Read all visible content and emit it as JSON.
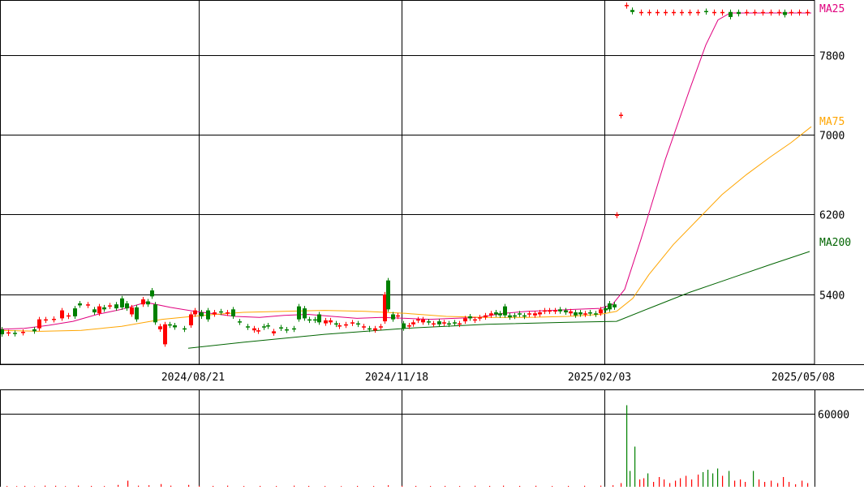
{
  "chart_data": [
    {
      "type": "candlestick",
      "y_ticks": [
        5400,
        6200,
        7000,
        7800
      ],
      "y_tick_labels": [
        "5400",
        "6200",
        "7000",
        "7800"
      ],
      "ylim": [
        4700,
        8350
      ],
      "x_tick_labels": [
        "2024/08/21",
        "2024/11/18",
        "2025/02/03",
        "2025/05/08"
      ],
      "grid": true,
      "colors": {
        "up": "#ff0000",
        "down": "#008000",
        "ma25": "#e0007f",
        "ma75": "#ffa500",
        "ma200": "#006400",
        "grid": "#000000"
      },
      "moving_averages": [
        {
          "name": "MA25",
          "color": "#e0007f",
          "points": [
            [
              0,
              5050
            ],
            [
              30,
              5060
            ],
            [
              60,
              5090
            ],
            [
              90,
              5130
            ],
            [
              120,
              5200
            ],
            [
              150,
              5250
            ],
            [
              180,
              5320
            ],
            [
              210,
              5270
            ],
            [
              240,
              5230
            ],
            [
              260,
              5210
            ],
            [
              290,
              5180
            ],
            [
              320,
              5170
            ],
            [
              350,
              5190
            ],
            [
              380,
              5200
            ],
            [
              410,
              5180
            ],
            [
              440,
              5160
            ],
            [
              470,
              5170
            ],
            [
              500,
              5160
            ],
            [
              530,
              5150
            ],
            [
              560,
              5160
            ],
            [
              590,
              5170
            ],
            [
              620,
              5210
            ],
            [
              650,
              5230
            ],
            [
              680,
              5240
            ],
            [
              710,
              5250
            ],
            [
              740,
              5260
            ],
            [
              755,
              5300
            ],
            [
              770,
              5450
            ],
            [
              790,
              5950
            ],
            [
              820,
              6750
            ],
            [
              850,
              7450
            ],
            [
              870,
              7900
            ],
            [
              885,
              8150
            ],
            [
              900,
              8220
            ],
            [
              950,
              8220
            ],
            [
              1000,
              8220
            ]
          ]
        },
        {
          "name": "MA75",
          "color": "#ffa500",
          "points": [
            [
              0,
              5040
            ],
            [
              50,
              5030
            ],
            [
              100,
              5040
            ],
            [
              150,
              5080
            ],
            [
              200,
              5150
            ],
            [
              250,
              5190
            ],
            [
              300,
              5220
            ],
            [
              350,
              5230
            ],
            [
              400,
              5240
            ],
            [
              450,
              5230
            ],
            [
              500,
              5210
            ],
            [
              550,
              5180
            ],
            [
              600,
              5170
            ],
            [
              650,
              5170
            ],
            [
              700,
              5180
            ],
            [
              740,
              5200
            ],
            [
              760,
              5230
            ],
            [
              780,
              5360
            ],
            [
              800,
              5600
            ],
            [
              830,
              5900
            ],
            [
              860,
              6150
            ],
            [
              890,
              6400
            ],
            [
              920,
              6600
            ],
            [
              950,
              6780
            ],
            [
              975,
              6920
            ],
            [
              1000,
              7080
            ]
          ]
        },
        {
          "name": "MA200",
          "color": "#006400",
          "points": [
            [
              232,
              4860
            ],
            [
              300,
              4920
            ],
            [
              400,
              5000
            ],
            [
              500,
              5060
            ],
            [
              600,
              5100
            ],
            [
              700,
              5120
            ],
            [
              760,
              5130
            ],
            [
              800,
              5260
            ],
            [
              850,
              5420
            ],
            [
              900,
              5560
            ],
            [
              950,
              5700
            ],
            [
              998,
              5830
            ]
          ]
        }
      ],
      "ma_labels": [
        "MA25",
        "MA75",
        "MA200"
      ],
      "candles": [
        [
          2,
          5050,
          5000
        ],
        [
          10,
          5010,
          5020
        ],
        [
          18,
          5015,
          5010
        ],
        [
          28,
          5020,
          5025
        ],
        [
          42,
          5050,
          5030
        ],
        [
          48,
          5060,
          5150
        ],
        [
          56,
          5140,
          5150
        ],
        [
          66,
          5150,
          5155
        ],
        [
          76,
          5160,
          5240
        ],
        [
          84,
          5180,
          5190
        ],
        [
          92,
          5260,
          5180
        ],
        [
          98,
          5310,
          5290
        ],
        [
          108,
          5290,
          5300
        ],
        [
          116,
          5250,
          5220
        ],
        [
          122,
          5210,
          5280
        ],
        [
          128,
          5270,
          5250
        ],
        [
          135,
          5280,
          5290
        ],
        [
          143,
          5300,
          5260
        ],
        [
          150,
          5360,
          5270
        ],
        [
          156,
          5310,
          5260
        ],
        [
          162,
          5200,
          5270
        ],
        [
          168,
          5270,
          5150
        ],
        [
          176,
          5300,
          5350
        ],
        [
          182,
          5330,
          5300
        ],
        [
          187,
          5440,
          5380
        ],
        [
          191,
          5300,
          5120
        ],
        [
          197,
          5050,
          5080
        ],
        [
          203,
          4900,
          5100
        ],
        [
          209,
          5100,
          5090
        ],
        [
          215,
          5090,
          5070
        ],
        [
          227,
          5060,
          5050
        ],
        [
          235,
          5090,
          5200
        ],
        [
          240,
          5200,
          5240
        ],
        [
          248,
          5220,
          5180
        ],
        [
          256,
          5240,
          5150
        ],
        [
          264,
          5200,
          5220
        ],
        [
          272,
          5230,
          5220
        ],
        [
          280,
          5210,
          5220
        ],
        [
          287,
          5250,
          5180
        ],
        [
          295,
          5130,
          5120
        ],
        [
          305,
          5080,
          5070
        ],
        [
          313,
          5040,
          5060
        ],
        [
          318,
          5030,
          5040
        ],
        [
          325,
          5080,
          5070
        ],
        [
          330,
          5090,
          5080
        ],
        [
          337,
          5010,
          5030
        ],
        [
          346,
          5070,
          5060
        ],
        [
          353,
          5050,
          5040
        ],
        [
          362,
          5060,
          5050
        ],
        [
          368,
          5280,
          5150
        ],
        [
          375,
          5260,
          5160
        ],
        [
          381,
          5150,
          5140
        ],
        [
          388,
          5150,
          5140
        ],
        [
          393,
          5200,
          5120
        ],
        [
          401,
          5110,
          5140
        ],
        [
          407,
          5120,
          5140
        ],
        [
          414,
          5110,
          5100
        ],
        [
          418,
          5080,
          5090
        ],
        [
          426,
          5100,
          5100
        ],
        [
          434,
          5110,
          5120
        ],
        [
          441,
          5110,
          5100
        ],
        [
          448,
          5070,
          5080
        ],
        [
          455,
          5060,
          5050
        ],
        [
          462,
          5040,
          5060
        ],
        [
          469,
          5070,
          5080
        ],
        [
          474,
          5130,
          5400
        ],
        [
          478,
          5540,
          5250
        ],
        [
          484,
          5200,
          5150
        ],
        [
          490,
          5180,
          5190
        ],
        [
          497,
          5110,
          5060
        ],
        [
          504,
          5080,
          5090
        ],
        [
          509,
          5100,
          5120
        ],
        [
          515,
          5140,
          5150
        ],
        [
          521,
          5120,
          5150
        ],
        [
          528,
          5130,
          5120
        ],
        [
          534,
          5100,
          5110
        ],
        [
          541,
          5130,
          5100
        ],
        [
          547,
          5110,
          5120
        ],
        [
          553,
          5110,
          5100
        ],
        [
          560,
          5120,
          5110
        ],
        [
          566,
          5110,
          5110
        ],
        [
          573,
          5130,
          5160
        ],
        [
          579,
          5180,
          5160
        ],
        [
          585,
          5140,
          5150
        ],
        [
          591,
          5160,
          5170
        ],
        [
          598,
          5170,
          5190
        ],
        [
          605,
          5190,
          5210
        ],
        [
          611,
          5220,
          5200
        ],
        [
          616,
          5210,
          5190
        ],
        [
          622,
          5280,
          5190
        ],
        [
          628,
          5190,
          5170
        ],
        [
          634,
          5190,
          5180
        ],
        [
          640,
          5210,
          5200
        ],
        [
          646,
          5190,
          5180
        ],
        [
          652,
          5200,
          5210
        ],
        [
          659,
          5190,
          5210
        ],
        [
          665,
          5200,
          5220
        ],
        [
          671,
          5230,
          5240
        ],
        [
          677,
          5230,
          5240
        ],
        [
          684,
          5240,
          5240
        ],
        [
          690,
          5250,
          5230
        ],
        [
          697,
          5240,
          5220
        ],
        [
          703,
          5210,
          5230
        ],
        [
          709,
          5220,
          5190
        ],
        [
          715,
          5220,
          5200
        ],
        [
          721,
          5200,
          5210
        ],
        [
          727,
          5220,
          5210
        ],
        [
          734,
          5210,
          5200
        ],
        [
          740,
          5210,
          5250
        ],
        [
          746,
          5260,
          5240
        ],
        [
          751,
          5310,
          5250
        ],
        [
          757,
          5300,
          5270
        ],
        [
          760,
          6200,
          6200
        ],
        [
          765,
          7200,
          7200
        ],
        [
          772,
          8300,
          8300
        ],
        [
          779,
          8250,
          8230
        ],
        [
          790,
          8230,
          8230
        ],
        [
          800,
          8230,
          8230
        ],
        [
          810,
          8230,
          8230
        ],
        [
          820,
          8230,
          8230
        ],
        [
          830,
          8230,
          8230
        ],
        [
          840,
          8230,
          8230
        ],
        [
          850,
          8230,
          8230
        ],
        [
          860,
          8230,
          8230
        ],
        [
          870,
          8240,
          8230
        ],
        [
          880,
          8230,
          8230
        ],
        [
          890,
          8230,
          8230
        ],
        [
          900,
          8230,
          8180
        ],
        [
          910,
          8230,
          8210
        ],
        [
          920,
          8220,
          8230
        ],
        [
          930,
          8220,
          8230
        ],
        [
          940,
          8230,
          8230
        ],
        [
          950,
          8230,
          8230
        ],
        [
          960,
          8230,
          8230
        ],
        [
          967,
          8230,
          8200
        ],
        [
          975,
          8230,
          8230
        ],
        [
          985,
          8230,
          8230
        ],
        [
          995,
          8230,
          8230
        ]
      ]
    },
    {
      "type": "bar",
      "y_ticks": [
        60000
      ],
      "y_tick_labels": [
        "60000"
      ],
      "ylim": [
        0,
        80000
      ],
      "grid": true,
      "volume_bars": [
        [
          8,
          600
        ],
        [
          20,
          500
        ],
        [
          30,
          700
        ],
        [
          42,
          400
        ],
        [
          55,
          900
        ],
        [
          68,
          800
        ],
        [
          80,
          500
        ],
        [
          96,
          900
        ],
        [
          112,
          700
        ],
        [
          128,
          600
        ],
        [
          145,
          1500
        ],
        [
          157,
          5000
        ],
        [
          170,
          900
        ],
        [
          183,
          1200
        ],
        [
          198,
          2200
        ],
        [
          210,
          900
        ],
        [
          232,
          1500
        ],
        [
          245,
          800
        ],
        [
          262,
          700
        ],
        [
          280,
          900
        ],
        [
          300,
          600
        ],
        [
          320,
          700
        ],
        [
          340,
          600
        ],
        [
          362,
          900
        ],
        [
          380,
          700
        ],
        [
          400,
          600
        ],
        [
          420,
          500
        ],
        [
          440,
          700
        ],
        [
          460,
          600
        ],
        [
          478,
          1200
        ],
        [
          495,
          800
        ],
        [
          512,
          700
        ],
        [
          530,
          600
        ],
        [
          548,
          700
        ],
        [
          566,
          600
        ],
        [
          585,
          800
        ],
        [
          603,
          700
        ],
        [
          620,
          900
        ],
        [
          640,
          700
        ],
        [
          660,
          800
        ],
        [
          680,
          600
        ],
        [
          700,
          700
        ],
        [
          720,
          800
        ],
        [
          740,
          900
        ],
        [
          755,
          1200
        ],
        [
          765,
          3000
        ],
        [
          772,
          67000
        ],
        [
          776,
          13000
        ],
        [
          782,
          33000
        ],
        [
          788,
          6000
        ],
        [
          793,
          7000
        ],
        [
          798,
          11000
        ],
        [
          805,
          4000
        ],
        [
          812,
          8000
        ],
        [
          818,
          6000
        ],
        [
          825,
          3000
        ],
        [
          832,
          5000
        ],
        [
          838,
          7000
        ],
        [
          845,
          9000
        ],
        [
          852,
          6000
        ],
        [
          860,
          10000
        ],
        [
          866,
          12000
        ],
        [
          872,
          14000
        ],
        [
          878,
          11000
        ],
        [
          884,
          15000
        ],
        [
          890,
          9000
        ],
        [
          898,
          13000
        ],
        [
          905,
          5000
        ],
        [
          912,
          6000
        ],
        [
          918,
          4000
        ],
        [
          928,
          13000
        ],
        [
          935,
          6000
        ],
        [
          942,
          4000
        ],
        [
          950,
          5000
        ],
        [
          958,
          3000
        ],
        [
          965,
          8000
        ],
        [
          972,
          4000
        ],
        [
          980,
          2000
        ],
        [
          988,
          5000
        ],
        [
          995,
          3000
        ]
      ]
    }
  ]
}
